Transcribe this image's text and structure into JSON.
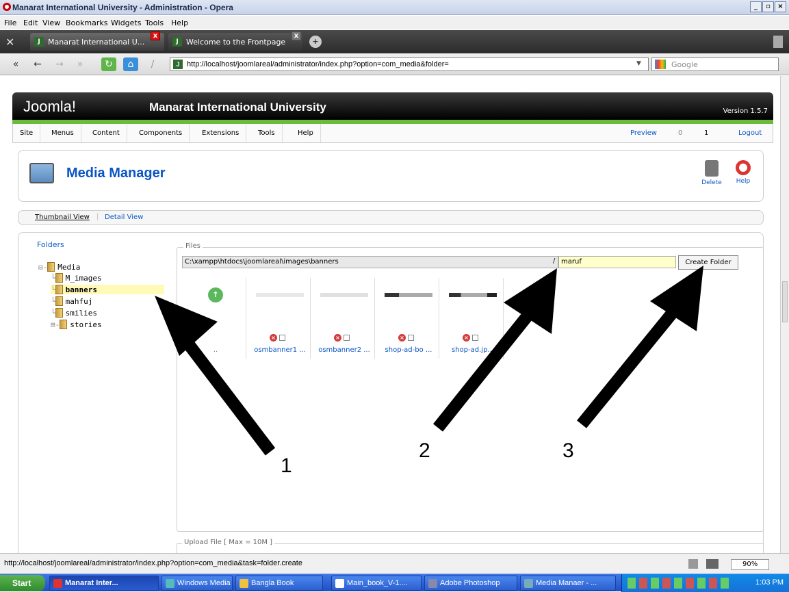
{
  "window": {
    "title": "Manarat International University - Administration - Opera"
  },
  "menubar": [
    "File",
    "Edit",
    "View",
    "Bookmarks",
    "Widgets",
    "Tools",
    "Help"
  ],
  "tabs": [
    {
      "label": "Manarat International U..."
    },
    {
      "label": "Welcome to the Frontpage"
    }
  ],
  "address": {
    "url": "http://localhost/joomlareal/administrator/index.php?option=com_media&folder=",
    "search_placeholder": "Google"
  },
  "joomla": {
    "logo": "Joomla!",
    "site_title": "Manarat International University",
    "version": "Version 1.5.7",
    "menu": [
      "Site",
      "Menus",
      "Content",
      "Components",
      "Extensions",
      "Tools",
      "Help"
    ],
    "right_menu": {
      "preview": "Preview",
      "messages": "0",
      "users": "1",
      "logout": "Logout"
    }
  },
  "media_manager": {
    "title": "Media Manager",
    "delete_label": "Delete",
    "help_label": "Help",
    "views": [
      "Thumbnail View",
      "Detail View"
    ],
    "folders_title": "Folders",
    "tree": {
      "root": "Media",
      "children": [
        "M_images",
        "banners",
        "mahfuj",
        "smilies",
        "stories"
      ],
      "selected": "banners"
    },
    "files_legend": "Files",
    "path": "C:\\xampp\\htdocs\\joomlareal\\images\\banners",
    "separator": "/",
    "new_folder_value": "maruf",
    "create_folder_label": "Create Folder",
    "thumbnails": [
      {
        "name": ".."
      },
      {
        "name": "osmbanner1 ..."
      },
      {
        "name": "osmbanner2 ..."
      },
      {
        "name": "shop-ad-bo ..."
      },
      {
        "name": "shop-ad.jp..."
      }
    ],
    "upload_legend": "Upload File [ Max = 10M ]"
  },
  "annotations": [
    "1",
    "2",
    "3"
  ],
  "status": {
    "text": "http://localhost/joomlareal/administrator/index.php?option=com_media&task=folder.create",
    "zoom": "90%"
  },
  "taskbar": {
    "start": "Start",
    "tasks": [
      "Manarat Inter...",
      "Windows Media ...",
      "Bangla Book",
      "Main_book_V-1....",
      "Adobe Photoshop",
      "Media Manaer - ..."
    ],
    "clock": "1:03 PM"
  },
  "colors": {
    "joomla_blue": "#0b55c4",
    "joomla_green": "#6cbb3c",
    "selected_row": "#fffbb7"
  }
}
